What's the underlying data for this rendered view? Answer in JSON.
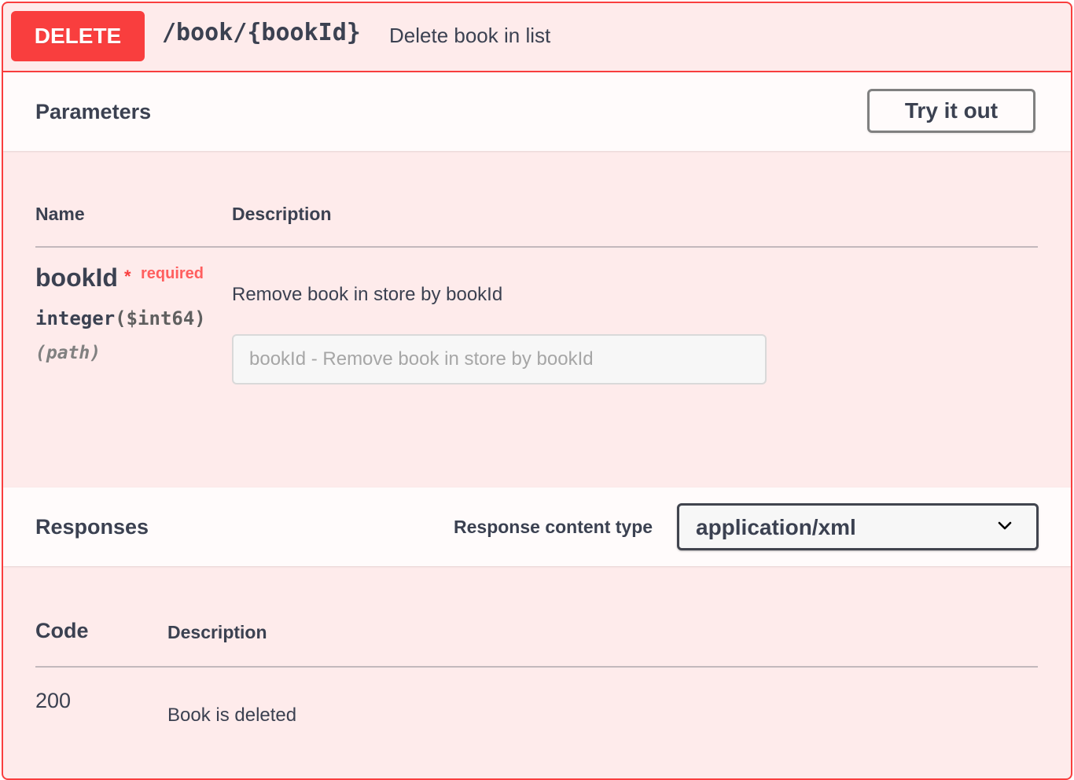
{
  "operation": {
    "method": "DELETE",
    "path": "/book/{bookId}",
    "summary": "Delete book in list"
  },
  "parameters": {
    "title": "Parameters",
    "try_button": "Try it out",
    "columns": {
      "name": "Name",
      "description": "Description"
    },
    "items": [
      {
        "name": "bookId",
        "required_star": "*",
        "required_label": "required",
        "type": "integer",
        "format": "($int64)",
        "in": "(path)",
        "description": "Remove book in store by bookId",
        "input_placeholder": "bookId - Remove book in store by bookId",
        "input_value": ""
      }
    ]
  },
  "responses": {
    "title": "Responses",
    "content_type_label": "Response content type",
    "content_type_selected": "application/xml",
    "columns": {
      "code": "Code",
      "description": "Description"
    },
    "items": [
      {
        "code": "200",
        "description": "Book is deleted"
      }
    ]
  },
  "colors": {
    "delete": "#f93e3e",
    "text": "#3b4151",
    "required": "#f93e3e"
  },
  "icons": {
    "select_arrow": "chevron-down-icon"
  }
}
